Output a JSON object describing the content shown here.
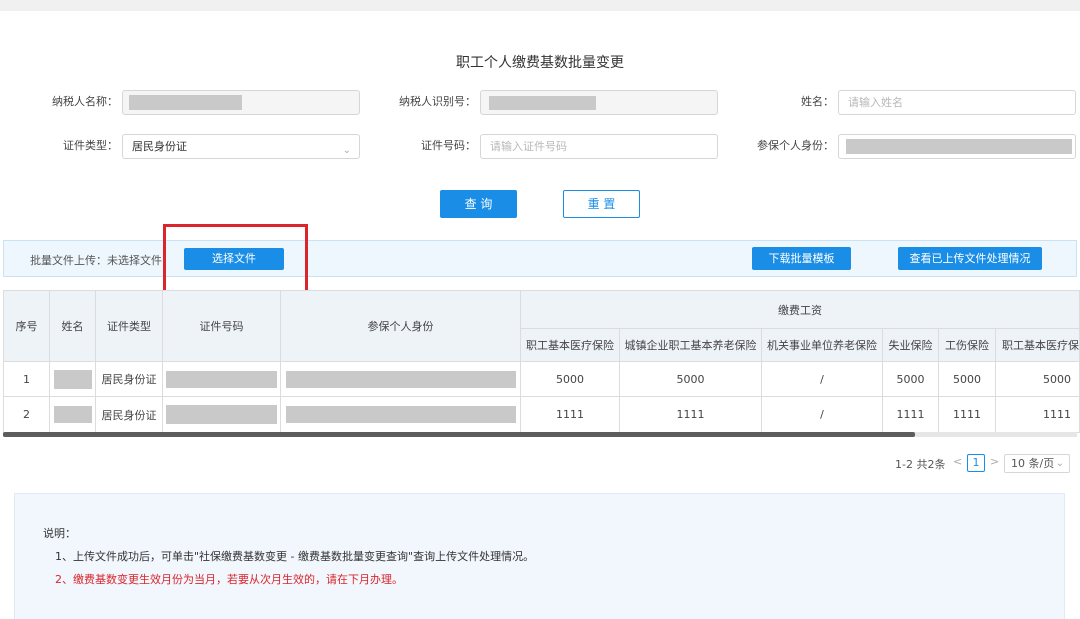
{
  "page": {
    "title": "职工个人缴费基数批量变更"
  },
  "form": {
    "taxpayer_name_label": "纳税人名称：",
    "taxpayer_id_label": "纳税人识别号：",
    "name_label": "姓名：",
    "name_placeholder": "请输入姓名",
    "cert_type_label": "证件类型：",
    "cert_type_value": "居民身份证",
    "cert_no_label": "证件号码：",
    "cert_no_placeholder": "请输入证件号码",
    "insured_identity_label": "参保个人身份："
  },
  "actions": {
    "query_label": "查 询",
    "reset_label": "重 置"
  },
  "upload": {
    "label": "批量文件上传：未选择文件",
    "choose_file_label": "选择文件",
    "download_template_label": "下载批量模板",
    "view_processing_label": "查看已上传文件处理情况"
  },
  "table": {
    "headers": {
      "seq": "序号",
      "name": "姓名",
      "cert_type": "证件类型",
      "cert_no": "证件号码",
      "insured_identity": "参保个人身份",
      "wage_group": "缴费工资"
    },
    "sub_headers": [
      "职工基本医疗保险",
      "城镇企业职工基本养老保险",
      "机关事业单位养老保险",
      "失业保险",
      "工伤保险",
      "职工基本医疗保"
    ],
    "rows": [
      {
        "seq": "1",
        "cert_type": "居民身份证",
        "values": [
          "5000",
          "5000",
          "/",
          "5000",
          "5000",
          "5000"
        ]
      },
      {
        "seq": "2",
        "cert_type": "居民身份证",
        "values": [
          "1111",
          "1111",
          "/",
          "1111",
          "1111",
          "1111"
        ]
      }
    ]
  },
  "pagination": {
    "total_text": "1-2 共2条",
    "prev": "<",
    "current": "1",
    "next": ">",
    "page_size": "10 条/页"
  },
  "notes": {
    "title": "说明：",
    "line1": "1、上传文件成功后，可单击\"社保缴费基数变更 - 缴费基数批量变更查询\"查询上传文件处理情况。",
    "line2": "2、缴费基数变更生效月份为当月，若要从次月生效的，请在下月办理。"
  },
  "colors": {
    "primary": "#1a8de6",
    "highlight_border": "#d9252b",
    "warning_text": "#d9252b"
  }
}
